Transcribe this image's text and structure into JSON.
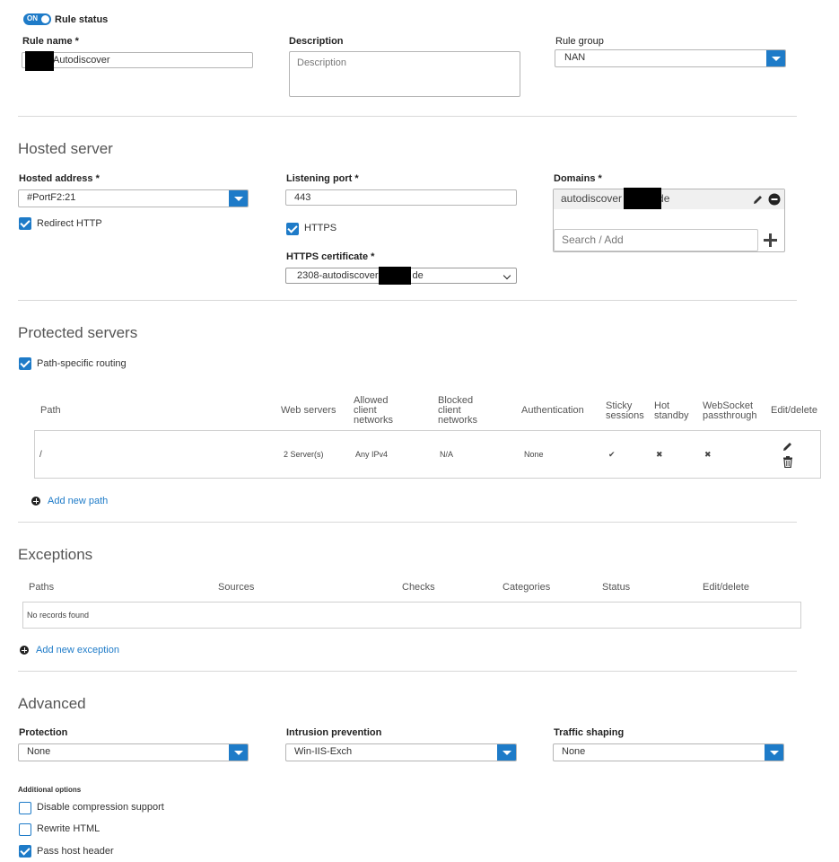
{
  "rule_status": {
    "toggle": "ON",
    "label": "Rule status"
  },
  "rule_name": {
    "label": "Rule name *",
    "value": "Autodiscover"
  },
  "description": {
    "label": "Description",
    "placeholder": "Description"
  },
  "rule_group": {
    "label": "Rule group",
    "value": "NAN"
  },
  "hosted_server": {
    "title": "Hosted server",
    "hosted_address": {
      "label": "Hosted address *",
      "value": "#PortF2:21"
    },
    "redirect_http": {
      "label": "Redirect HTTP",
      "checked": true
    },
    "listening_port": {
      "label": "Listening port *",
      "value": "443"
    },
    "https": {
      "label": "HTTPS",
      "checked": true
    },
    "https_certificate": {
      "label": "HTTPS certificate *",
      "value_prefix": "2308-autodiscover",
      "value_suffix": "de"
    },
    "domains": {
      "label": "Domains *",
      "item_prefix": "autodiscover",
      "item_suffix": "de",
      "search_placeholder": "Search / Add"
    }
  },
  "protected_servers": {
    "title": "Protected servers",
    "path_routing": {
      "label": "Path-specific routing",
      "checked": true
    },
    "columns": [
      "Path",
      "Web servers",
      "Allowed client networks",
      "Blocked client networks",
      "Authentication",
      "Sticky sessions",
      "Hot standby",
      "WebSocket passthrough",
      "Edit/delete"
    ],
    "rows": [
      {
        "path": "/",
        "web_servers": "2 Server(s)",
        "allowed": "Any IPv4",
        "blocked": "N/A",
        "auth": "None",
        "sticky": "✔",
        "hot_standby": "✖",
        "websocket": "✖"
      }
    ],
    "add_link": "Add new path"
  },
  "exceptions": {
    "title": "Exceptions",
    "columns": [
      "Paths",
      "Sources",
      "Checks",
      "Categories",
      "Status",
      "Edit/delete"
    ],
    "empty": "No records found",
    "add_link": "Add new exception"
  },
  "advanced": {
    "title": "Advanced",
    "protection": {
      "label": "Protection",
      "value": "None"
    },
    "intrusion": {
      "label": "Intrusion prevention",
      "value": "Win-IIS-Exch"
    },
    "traffic": {
      "label": "Traffic shaping",
      "value": "None"
    },
    "additional_label": "Additional options",
    "options": [
      {
        "label": "Disable compression support",
        "checked": false
      },
      {
        "label": "Rewrite HTML",
        "checked": false
      },
      {
        "label": "Pass host header",
        "checked": true
      }
    ]
  },
  "colors": {
    "accent": "#1e7bc8"
  }
}
